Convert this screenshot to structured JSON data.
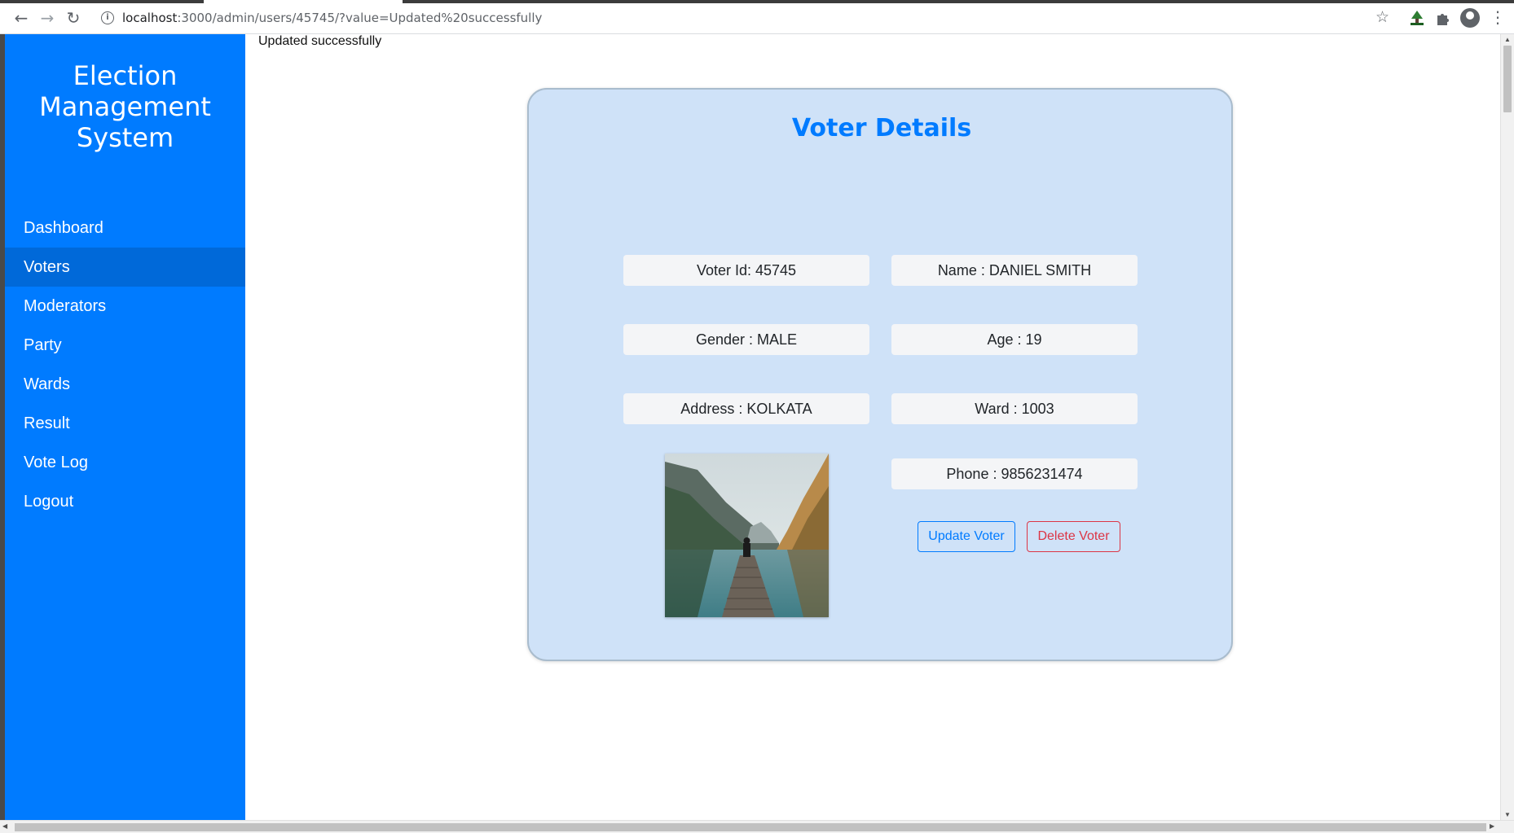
{
  "browser": {
    "url_host": "localhost",
    "url_rest": ":3000/admin/users/45745/?value=Updated%20successfully",
    "back_icon": "arrow-left-icon",
    "forward_icon": "arrow-right-icon",
    "reload_icon": "reload-icon"
  },
  "sidebar": {
    "brand_line1": "Election",
    "brand_line2": "Management",
    "brand_line3": "System",
    "items": [
      {
        "label": "Dashboard"
      },
      {
        "label": "Voters"
      },
      {
        "label": "Moderators"
      },
      {
        "label": "Party"
      },
      {
        "label": "Wards"
      },
      {
        "label": "Result"
      },
      {
        "label": "Vote Log"
      },
      {
        "label": "Logout"
      }
    ],
    "active_item": "Voters"
  },
  "main": {
    "flash_message": "Updated successfully",
    "card": {
      "title": "Voter Details",
      "voter_id": "Voter Id: 45745",
      "name": "Name : DANIEL SMITH",
      "gender": "Gender : MALE",
      "age": "Age : 19",
      "address": "Address : KOLKATA",
      "ward": "Ward : 1003",
      "phone": "Phone : 9856231474",
      "update_label": "Update Voter",
      "delete_label": "Delete Voter"
    }
  },
  "colors": {
    "primary": "#007bff",
    "primary_active": "#0069d9",
    "card_bg": "#cfe2f8",
    "danger": "#dc3545",
    "field_bg": "#f4f5f7"
  }
}
